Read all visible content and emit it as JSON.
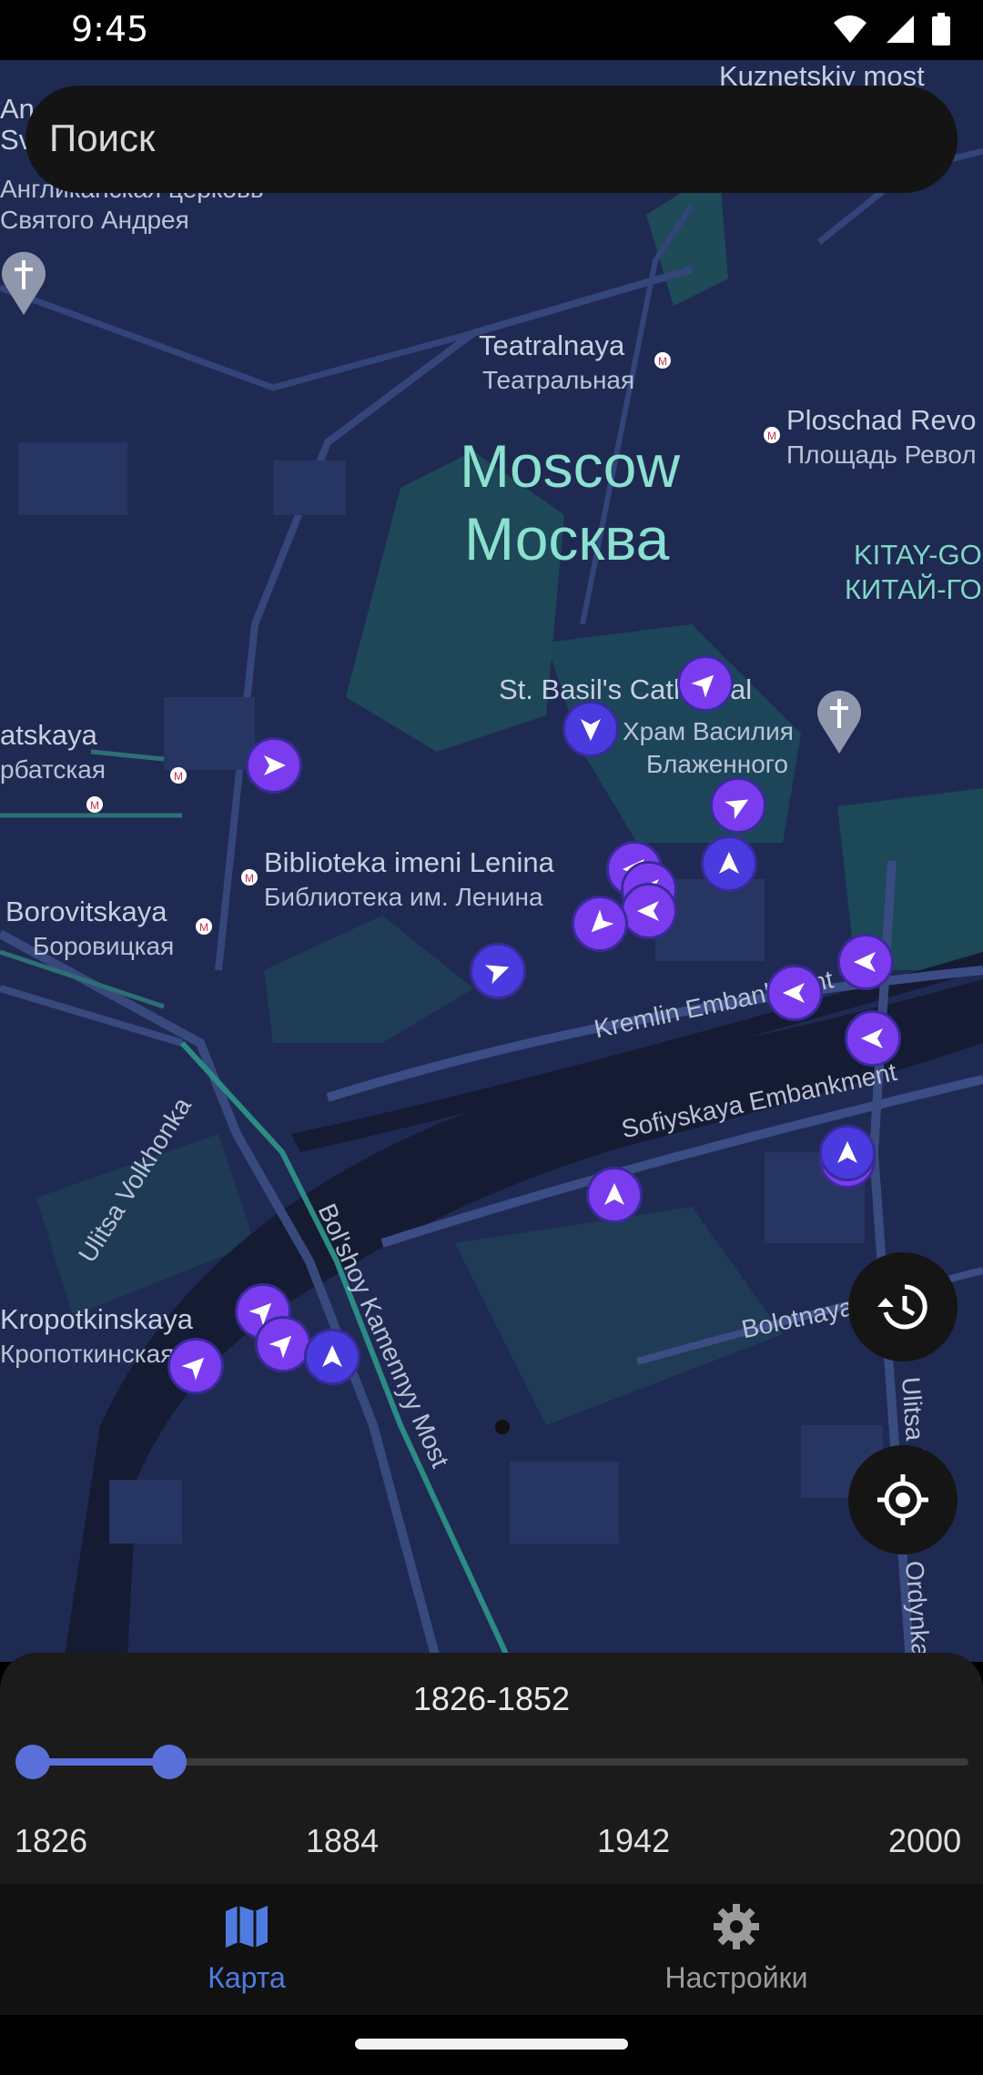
{
  "status": {
    "time": "9:45"
  },
  "search": {
    "placeholder": "Поиск"
  },
  "map": {
    "labels": {
      "kuznetskiy": "Kuznetskiy most",
      "an": "An",
      "sv": "Svy",
      "anglican": "Англиканская церковь",
      "andrew": "Святого Андрея",
      "teatralnaya_en": "Teatralnaya",
      "teatralnaya_ru": "Театральная",
      "ploschad_en": "Ploschad Revo",
      "ploschad_ru": "Площадь Револ",
      "moscow_en": "Moscow",
      "moscow_ru": "Москва",
      "kitay_en": "KITAY-GO",
      "kitay_ru": "КИТАЙ-ГО",
      "basil_en": "St. Basil's Cathedral",
      "basil_ru1": "Храм Василия",
      "basil_ru2": "Блаженного",
      "arbat_en": "atskaya",
      "arbat_ru": "рбатская",
      "lenina_en": "Biblioteka imeni Lenina",
      "lenina_ru": "Библиотека им. Ленина",
      "borov_en": "Borovitskaya",
      "borov_ru": "Боровицкая",
      "kremlin_emb": "Kremlin Embankment",
      "sofiyskaya": "Sofiyskaya Embankment",
      "volkhonka": "Ulitsa Volkhonka",
      "kropot_en": "Kropotkinskaya",
      "kropot_ru": "Кропоткинская",
      "bkm": "Bol'shoy Kamennyy Most",
      "bolotnaya": "Bolotnaya St.",
      "ulitsa_r": "Ulitsa B",
      "ordynka": "Ordynka"
    },
    "markers": [
      {
        "color": "violet",
        "dir": "up-right"
      },
      {
        "color": "indigo",
        "dir": "down"
      },
      {
        "color": "violet",
        "dir": "right"
      },
      {
        "color": "violet",
        "dir": "up-right"
      },
      {
        "color": "indigo",
        "dir": "up"
      },
      {
        "color": "violet",
        "dir": "left"
      },
      {
        "color": "violet",
        "dir": "up-left"
      },
      {
        "color": "indigo",
        "dir": "right"
      },
      {
        "color": "violet",
        "dir": "left"
      },
      {
        "color": "violet",
        "dir": "left"
      },
      {
        "color": "indigo",
        "dir": "up"
      },
      {
        "color": "violet",
        "dir": "up"
      },
      {
        "color": "violet",
        "dir": "up-right"
      },
      {
        "color": "violet",
        "dir": "up-right"
      },
      {
        "color": "indigo",
        "dir": "up"
      }
    ]
  },
  "buttons": {
    "history": "history-icon",
    "locate": "my-location-icon"
  },
  "timeline": {
    "range_label": "1826-1852",
    "min": 1826,
    "max": 2000,
    "range_start": 1826,
    "range_end": 1852,
    "ticks": [
      "1826",
      "1884",
      "1942",
      "2000"
    ]
  },
  "nav": {
    "map_label": "Карта",
    "settings_label": "Настройки",
    "active_color": "#4f7be0",
    "inactive_color": "#9a9a9a"
  }
}
